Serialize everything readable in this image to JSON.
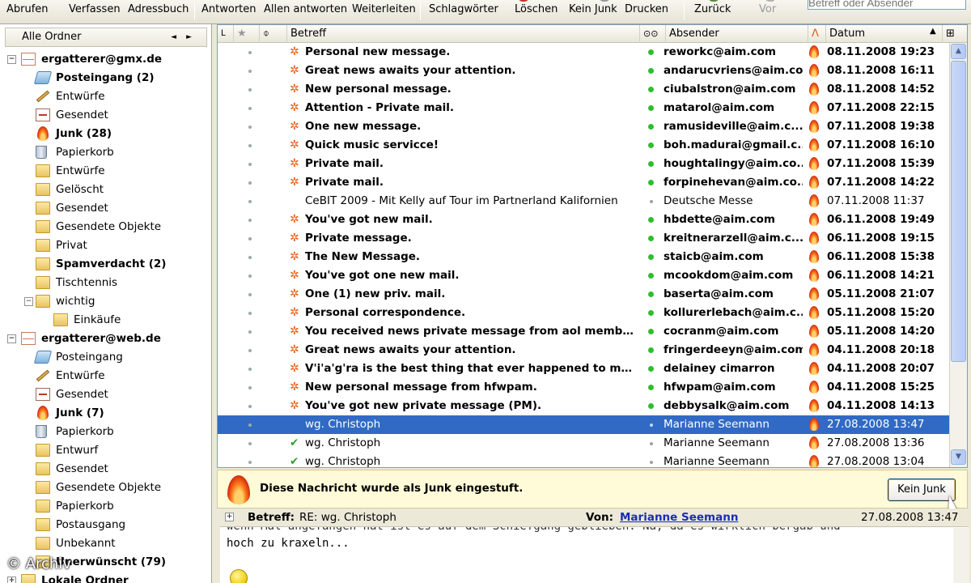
{
  "toolbar": {
    "buttons": [
      "Abrufen",
      "Verfassen",
      "Adressbuch",
      "Antworten",
      "Allen antworten",
      "Weiterleiten",
      "Schlagwörter",
      "Löschen",
      "Kein Junk",
      "Drucken",
      "Zurück",
      "Vor"
    ],
    "search_placeholder": "Betreff oder Absender"
  },
  "folders": {
    "header": "Alle Ordner",
    "items": [
      {
        "label": "ergatterer@gmx.de",
        "bold": true
      },
      {
        "label": "Posteingang (2)",
        "bold": true
      },
      {
        "label": "Entwürfe"
      },
      {
        "label": "Gesendet"
      },
      {
        "label": "Junk (28)",
        "bold": true
      },
      {
        "label": "Papierkorb"
      },
      {
        "label": "Entwürfe"
      },
      {
        "label": "Gelöscht"
      },
      {
        "label": "Gesendet"
      },
      {
        "label": "Gesendete Objekte"
      },
      {
        "label": "Privat"
      },
      {
        "label": "Spamverdacht (2)",
        "bold": true
      },
      {
        "label": "Tischtennis"
      },
      {
        "label": "wichtig"
      },
      {
        "label": "Einkäufe"
      },
      {
        "label": "ergatterer@web.de",
        "bold": true
      },
      {
        "label": "Posteingang"
      },
      {
        "label": "Entwürfe"
      },
      {
        "label": "Gesendet"
      },
      {
        "label": "Junk (7)",
        "bold": true
      },
      {
        "label": "Papierkorb"
      },
      {
        "label": "Entwurf"
      },
      {
        "label": "Gesendet"
      },
      {
        "label": "Gesendete Objekte"
      },
      {
        "label": "Papierkorb"
      },
      {
        "label": "Postausgang"
      },
      {
        "label": "Unbekannt"
      },
      {
        "label": "Unerwünscht (79)",
        "bold": true
      },
      {
        "label": "Lokale Ordner",
        "bold": true
      }
    ]
  },
  "columns": {
    "subject": "Betreff",
    "sender": "Absender",
    "date": "Datum"
  },
  "messages": [
    {
      "subject": "Personal new message.",
      "sender": "reworkc@aim.com",
      "date": "08.11.2008 19:23"
    },
    {
      "subject": "Great news awaits your attention.",
      "sender": "andarucvriens@aim.com",
      "date": "08.11.2008 16:11"
    },
    {
      "subject": "New personal message.",
      "sender": "ciubalstron@aim.com",
      "date": "08.11.2008 14:52"
    },
    {
      "subject": "Attention - Private mail.",
      "sender": "matarol@aim.com",
      "date": "07.11.2008 22:15"
    },
    {
      "subject": "One new message.",
      "sender": "ramusideville@aim.c...",
      "date": "07.11.2008 19:38"
    },
    {
      "subject": "Quick music servicce!",
      "sender": "boh.madurai@gmail.c...",
      "date": "07.11.2008 16:10"
    },
    {
      "subject": "Private mail.",
      "sender": "houghtalingy@aim.co...",
      "date": "07.11.2008 15:39"
    },
    {
      "subject": "Private mail.",
      "sender": "forpinehevan@aim.co...",
      "date": "07.11.2008 14:22"
    },
    {
      "subject": "CeBIT 2009 - Mit Kelly auf Tour im Partnerland Kalifornien",
      "sender": "Deutsche Messe",
      "date": "07.11.2008 11:37"
    },
    {
      "subject": "You've got new mail.",
      "sender": "hbdette@aim.com",
      "date": "06.11.2008 19:49"
    },
    {
      "subject": "Private message.",
      "sender": "kreitnerarzell@aim.c...",
      "date": "06.11.2008 19:15"
    },
    {
      "subject": "The New Message.",
      "sender": "staicb@aim.com",
      "date": "06.11.2008 15:38"
    },
    {
      "subject": "You've got one new mail.",
      "sender": "mcookdom@aim.com",
      "date": "06.11.2008 14:21"
    },
    {
      "subject": "One (1) new priv. mail.",
      "sender": "baserta@aim.com",
      "date": "05.11.2008 21:07"
    },
    {
      "subject": "Personal correspondence.",
      "sender": "kollurerlebach@aim.c...",
      "date": "05.11.2008 15:20"
    },
    {
      "subject": "You received news private message from aol member.",
      "sender": "cocranm@aim.com",
      "date": "05.11.2008 14:20"
    },
    {
      "subject": "Great news awaits your attention.",
      "sender": "fringerdeeyn@aim.com",
      "date": "04.11.2008 20:18"
    },
    {
      "subject": "V'i'a'g'ra is the best thing that ever happened to me. g...",
      "sender": "delainey cimarron",
      "date": "04.11.2008 20:07"
    },
    {
      "subject": "New personal message from hfwpam.",
      "sender": "hfwpam@aim.com",
      "date": "04.11.2008 15:25"
    },
    {
      "subject": "You've got new private message (PM).",
      "sender": "debbysalk@aim.com",
      "date": "04.11.2008 14:13"
    },
    {
      "subject": "wg. Christoph",
      "sender": "Marianne Seemann",
      "date": "27.08.2008 13:47"
    },
    {
      "subject": "wg. Christoph",
      "sender": "Marianne Seemann",
      "date": "27.08.2008 13:36"
    },
    {
      "subject": "wg. Christoph",
      "sender": "Marianne Seemann",
      "date": "27.08.2008 13:04"
    }
  ],
  "junk_bar": {
    "text": "Diese Nachricht wurde als Junk eingestuft.",
    "button": "Kein Junk"
  },
  "message_header": {
    "subject_label": "Betreff:",
    "subject": "RE: wg. Christoph",
    "from_label": "Von:",
    "from": "Marianne Seemann",
    "date": "27.08.2008 13:47"
  },
  "message_body": {
    "line_cut": "wenn Mal angefangen hat ist es auf dem Schiefgang geblieben. Na, da es wirklich bergab und",
    "line": "hoch zu kraxeln..."
  },
  "watermark": "© Archiv",
  "colors": {
    "selection": "#316ac5",
    "spam_star": "#e25a12",
    "read_green": "#2ebd2e",
    "link": "#1a2db5"
  }
}
